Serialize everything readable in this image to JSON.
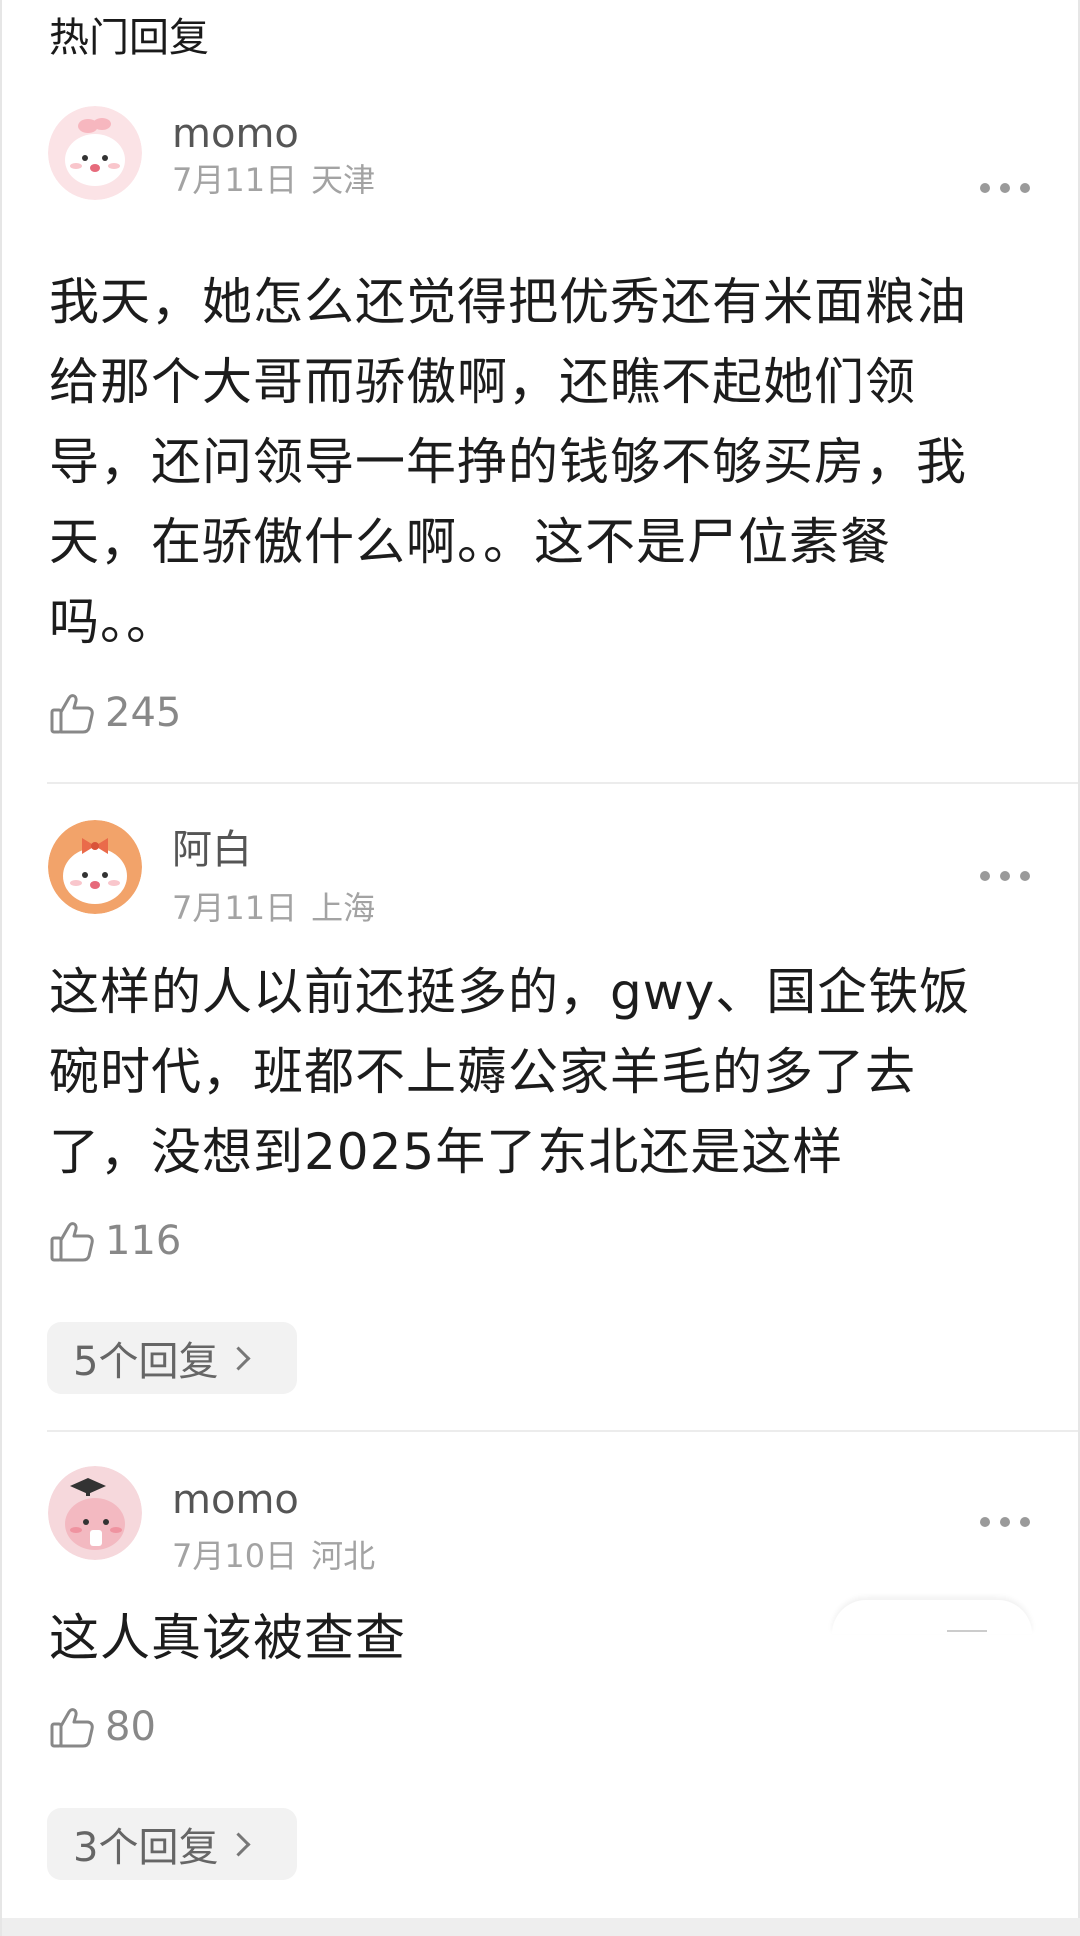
{
  "section": {
    "title": "热门回复"
  },
  "comments": [
    {
      "username": "momo",
      "date": "7月11日",
      "location": "天津",
      "lines": [
        "我天，她怎么还觉得把优秀还有米面粮油",
        "给那个大哥而骄傲啊，还瞧不起她们领",
        "导，还问领导一年挣的钱够不够买房，我",
        "天，在骄傲什么啊。。这不是尸位素餐",
        "吗。。"
      ],
      "likes": "245",
      "avatar_icon": "bunny-avatar-icon"
    },
    {
      "username": "阿白",
      "date": "7月11日",
      "location": "上海",
      "lines": [
        "这样的人以前还挺多的，gwy、国企铁饭",
        "碗时代，班都不上薅公家羊毛的多了去",
        "了，没想到2025年了东北还是这样"
      ],
      "likes": "116",
      "replies_label": "5个回复",
      "avatar_icon": "bunny-bow-avatar-icon"
    },
    {
      "username": "momo",
      "date": "7月10日",
      "location": "河北",
      "lines": [
        "这人真该被查查"
      ],
      "likes": "80",
      "replies_label": "3个回复",
      "avatar_icon": "bunny-graduate-avatar-icon"
    }
  ],
  "colors": {
    "username": "#555555",
    "meta": "#a3a3a3",
    "text": "#1c1c1c",
    "reply_bg": "#f2f2f2"
  }
}
